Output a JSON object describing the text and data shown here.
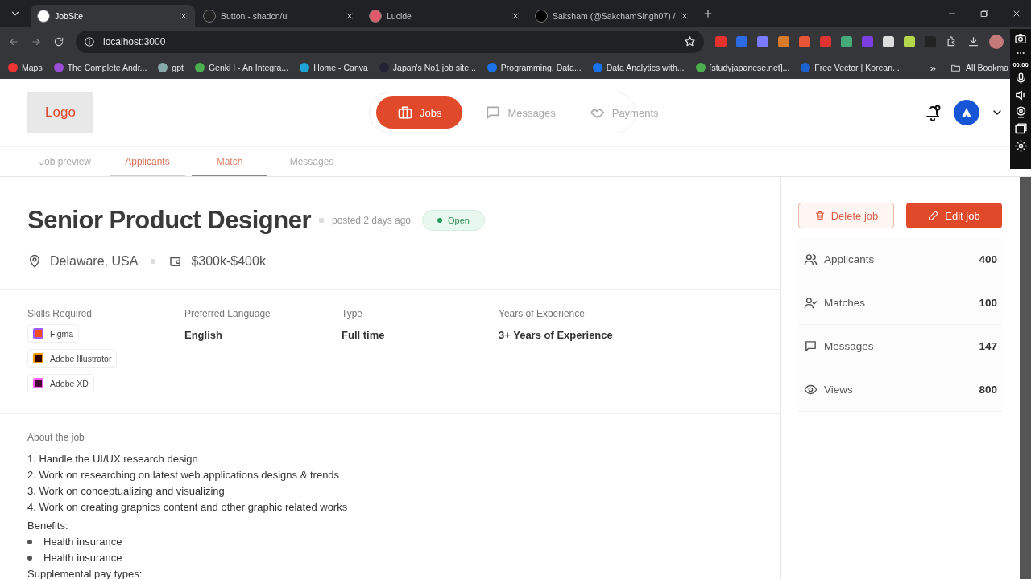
{
  "browser": {
    "tabs": [
      {
        "title": "JobSite",
        "selected": true
      },
      {
        "title": "Button - shadcn/ui",
        "selected": false
      },
      {
        "title": "Lucide",
        "selected": false
      },
      {
        "title": "Saksham (@SakchamSingh07) /",
        "selected": false
      }
    ],
    "address": "localhost:3000",
    "bookmarks": [
      "Maps",
      "The Complete Andr...",
      "gpt",
      "Genki I - An Integra...",
      "Home - Canva",
      "Japan's No1 job site...",
      "Programming, Data...",
      "Data Analytics with...",
      "[studyjapanese.net]...",
      "Free Vector | Korean..."
    ],
    "more_bookmarks": "»",
    "all_bookmarks": "All Bookma",
    "recorder_time": "00:00"
  },
  "header": {
    "logo": "Logo",
    "nav": [
      {
        "label": "Jobs",
        "selected": true
      },
      {
        "label": "Messages",
        "selected": false
      },
      {
        "label": "Payments",
        "selected": false
      }
    ]
  },
  "subnav": [
    {
      "label": "Job preview",
      "selected": false,
      "hovered": false
    },
    {
      "label": "Applicants",
      "selected": true,
      "hovered": false
    },
    {
      "label": "Match",
      "selected": false,
      "hovered": true
    },
    {
      "label": "Messages",
      "selected": false,
      "hovered": false
    }
  ],
  "job": {
    "title": "Senior Product Designer",
    "posted": "posted 2 days ago",
    "status": "Open",
    "location": "Delaware, USA",
    "salary": "$300k-$400k",
    "details": [
      {
        "label": "Skills Required",
        "skills": [
          "Figma",
          "Adobe Illustrator",
          "Adobe XD"
        ]
      },
      {
        "label": "Preferred Language",
        "value": "English"
      },
      {
        "label": "Type",
        "value": "Full time"
      },
      {
        "label": "Years of Experience",
        "value": "3+ Years of Experience"
      }
    ],
    "about": {
      "heading": "About the job",
      "lines": [
        "1. Handle the UI/UX research design",
        "2. Work on researching on latest web applications designs & trends",
        "3. Work on conceptualizing and visualizing",
        "4. Work on creating graphics content and other graphic related works"
      ],
      "benefits_heading": "Benefits:",
      "benefits": [
        "Health insurance",
        "Health insurance"
      ],
      "next_heading": "Supplemental pay types:"
    }
  },
  "side": {
    "delete": "Delete job",
    "edit": "Edit job",
    "stats": [
      {
        "label": "Applicants",
        "value": "400"
      },
      {
        "label": "Matches",
        "value": "100"
      },
      {
        "label": "Messages",
        "value": "147"
      },
      {
        "label": "Views",
        "value": "800"
      }
    ]
  }
}
